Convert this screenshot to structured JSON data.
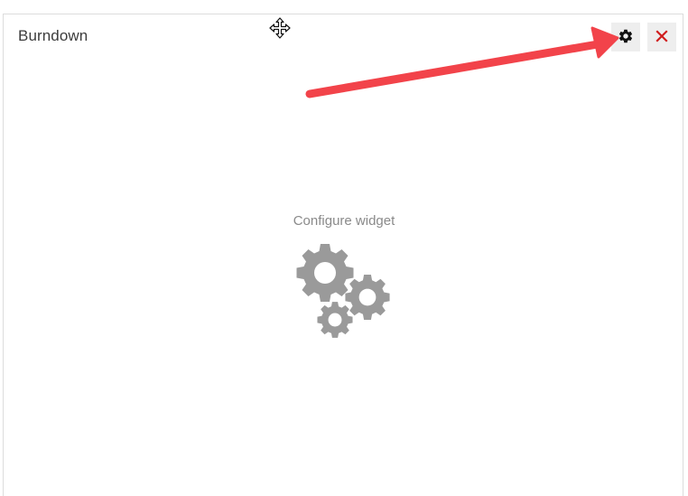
{
  "widget": {
    "title": "Burndown",
    "settings_button_icon": "gear-icon",
    "close_button_icon": "close-icon",
    "move_cursor_icon": "move-cursor-icon"
  },
  "body": {
    "configure_label": "Configure widget",
    "illustration_icon": "gears-icon"
  },
  "annotation": {
    "arrow_color": "#f2434a",
    "target": "settings-button"
  },
  "colors": {
    "close_icon": "#d01d1d",
    "gear_illustration": "#9a9a9a",
    "button_bg": "#eeeeee"
  }
}
